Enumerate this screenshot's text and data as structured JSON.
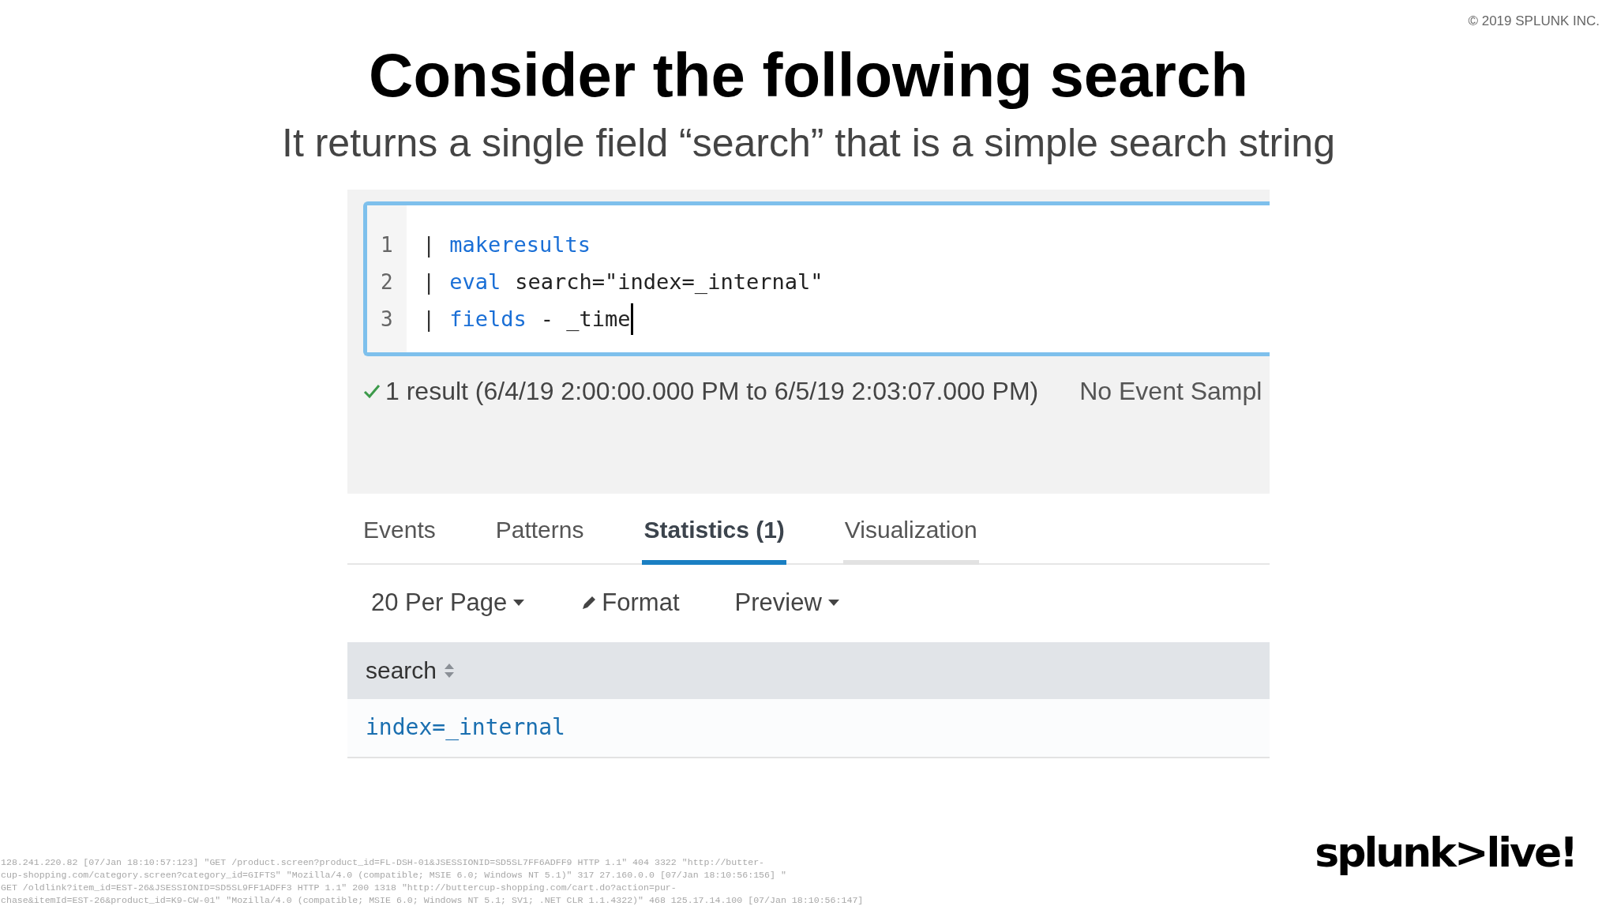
{
  "copyright": "© 2019 SPLUNK INC.",
  "title": "Consider the following search",
  "subtitle": "It returns a single field “search” that is a simple search string",
  "editor": {
    "lines": [
      {
        "number": "1",
        "tokens": [
          {
            "kind": "pipe",
            "text": "|"
          },
          {
            "kind": "command",
            "text": "makeresults"
          }
        ]
      },
      {
        "number": "2",
        "tokens": [
          {
            "kind": "pipe",
            "text": "|"
          },
          {
            "kind": "command",
            "text": "eval"
          },
          {
            "kind": "plain",
            "text": "search=\"index=_internal\""
          }
        ]
      },
      {
        "number": "3",
        "tokens": [
          {
            "kind": "pipe",
            "text": "|"
          },
          {
            "kind": "command",
            "text": "fields"
          },
          {
            "kind": "plain",
            "text": "- _time"
          }
        ],
        "cursor": true
      }
    ]
  },
  "status": {
    "result": "1 result (6/4/19 2:00:00.000 PM to 6/5/19 2:03:07.000 PM)",
    "sampling": "No Event Sampl"
  },
  "tabs": [
    {
      "label": "Events",
      "selected": false,
      "hover": false
    },
    {
      "label": "Patterns",
      "selected": false,
      "hover": false
    },
    {
      "label": "Statistics (1)",
      "selected": true,
      "hover": false
    },
    {
      "label": "Visualization",
      "selected": false,
      "hover": true
    }
  ],
  "toolbar": [
    {
      "kind": "dropdown",
      "label": "20 Per Page"
    },
    {
      "kind": "format",
      "label": "Format"
    },
    {
      "kind": "dropdown",
      "label": "Preview"
    }
  ],
  "table": {
    "columns": [
      "search"
    ],
    "rows": [
      [
        "index=_internal"
      ]
    ]
  },
  "log_lines": [
    "128.241.220.82 [07/Jan 18:10:57:123] \"GET /product.screen?product_id=FL-DSH-01&JSESSIONID=SD5SL7FF6ADFF9 HTTP 1.1\" 404 3322 \"http://butter-",
    "cup-shopping.com/category.screen?category_id=GIFTS\" \"Mozilla/4.0 (compatible; MSIE 6.0; Windows NT 5.1)\" 317 27.160.0.0 [07/Jan 18:10:56:156] \"",
    "GET /oldlink?item_id=EST-26&JSESSIONID=SD5SL9FF1ADFF3 HTTP 1.1\" 200 1318 \"http://buttercup-shopping.com/cart.do?action=pur-",
    "chase&itemId=EST-26&product_id=K9-CW-01\" \"Mozilla/4.0 (compatible; MSIE 6.0; Windows NT 5.1; SV1; .NET CLR 1.1.4322)\" 468 125.17.14.100 [07/Jan 18:10:56:147]"
  ],
  "logo": "splunk>live!"
}
